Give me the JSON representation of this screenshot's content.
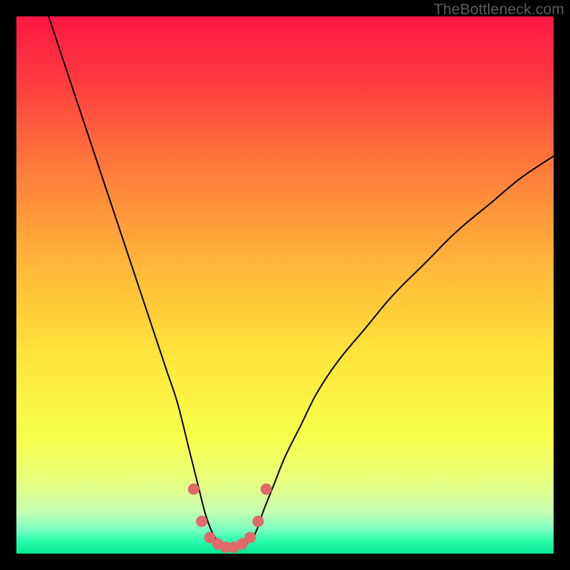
{
  "watermark": "TheBottleneck.com",
  "chart_data": {
    "type": "line",
    "title": "",
    "xlabel": "",
    "ylabel": "",
    "xlim": [
      0,
      100
    ],
    "ylim": [
      0,
      100
    ],
    "grid": false,
    "legend": false,
    "background": {
      "type": "vertical-gradient",
      "stops": [
        {
          "pos": 0.0,
          "color": "#ff1744"
        },
        {
          "pos": 0.12,
          "color": "#ff3b3f"
        },
        {
          "pos": 0.28,
          "color": "#ff7a3b"
        },
        {
          "pos": 0.45,
          "color": "#ffb339"
        },
        {
          "pos": 0.62,
          "color": "#ffe23a"
        },
        {
          "pos": 0.78,
          "color": "#f7ff4a"
        },
        {
          "pos": 0.86,
          "color": "#eaff7a"
        },
        {
          "pos": 0.92,
          "color": "#c8ffb0"
        },
        {
          "pos": 0.955,
          "color": "#7dffc1"
        },
        {
          "pos": 0.975,
          "color": "#2dffad"
        },
        {
          "pos": 1.0,
          "color": "#00e893"
        }
      ]
    },
    "series": [
      {
        "name": "bottleneck-curve",
        "color": "#000000",
        "width": 2,
        "x": [
          6,
          8,
          10,
          12,
          14,
          16,
          18,
          20,
          22,
          24,
          26,
          28,
          30,
          32,
          33,
          34,
          35,
          36,
          37,
          38,
          39,
          40,
          41,
          42,
          43,
          44,
          45,
          46,
          48,
          50,
          53,
          56,
          60,
          65,
          70,
          76,
          82,
          88,
          94,
          100
        ],
        "y": [
          100,
          94,
          88,
          82,
          76,
          70,
          64,
          58,
          52,
          46,
          40,
          34,
          28,
          20,
          16,
          12,
          8,
          5,
          3,
          2,
          1.5,
          1.2,
          1.2,
          1.5,
          2,
          3,
          5,
          8,
          13,
          18,
          24,
          30,
          36,
          42,
          48,
          54,
          60,
          65,
          70,
          74
        ]
      }
    ],
    "markers": {
      "name": "highlight-dots",
      "color": "#e06a6a",
      "radius": 8,
      "x": [
        33.0,
        34.5,
        36.0,
        37.5,
        39.0,
        40.5,
        42.0,
        43.5,
        45.0,
        46.5
      ],
      "y": [
        12,
        6,
        3,
        1.8,
        1.2,
        1.2,
        1.8,
        3,
        6,
        12
      ]
    }
  }
}
